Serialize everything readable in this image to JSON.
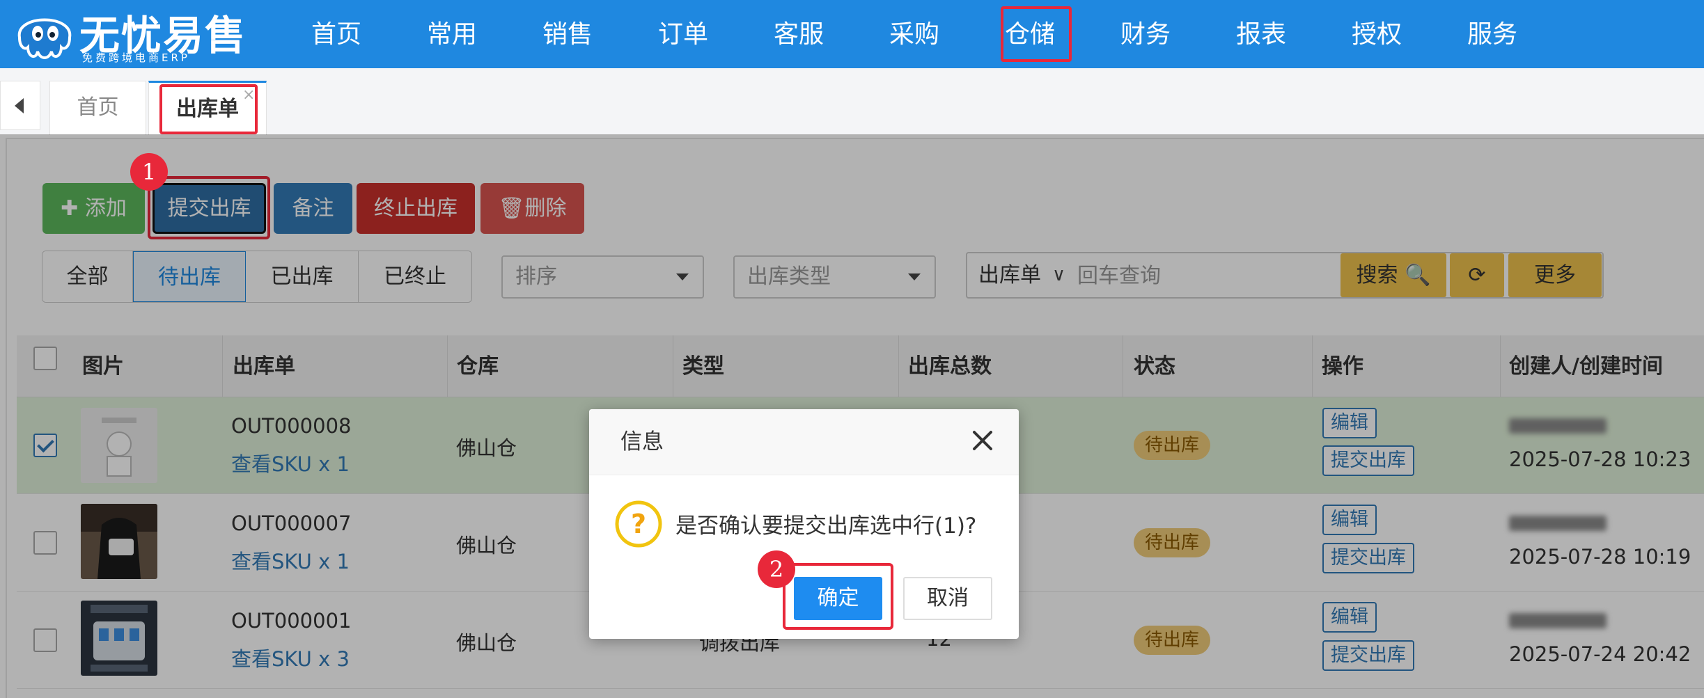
{
  "brand": {
    "name": "无忧易售",
    "tagline": "免费跨境电商ERP"
  },
  "nav": [
    "首页",
    "常用",
    "销售",
    "订单",
    "客服",
    "采购",
    "仓储",
    "财务",
    "报表",
    "授权",
    "服务"
  ],
  "tabs": {
    "home": "首页",
    "active": "出库单",
    "close": "×"
  },
  "toolbar": {
    "add": "添加",
    "submit": "提交出库",
    "note": "备注",
    "stop": "终止出库",
    "delete": "删除"
  },
  "filters": [
    "全部",
    "待出库",
    "已出库",
    "已终止"
  ],
  "selects": {
    "sort": "排序",
    "type": "出库类型"
  },
  "search": {
    "type": "出库单",
    "caret": "∨",
    "placeholder": "回车查询",
    "button": "搜索",
    "more": "更多"
  },
  "table": {
    "headers": [
      "图片",
      "出库单",
      "仓库",
      "类型",
      "出库总数",
      "状态",
      "操作",
      "创建人/创建时间"
    ],
    "rows": [
      {
        "order": "OUT000008",
        "sku": "查看SKU x 1",
        "warehouse": "佛山仓",
        "type": "",
        "total": "",
        "status": "待出库",
        "edit": "编辑",
        "submit": "提交出库",
        "time": "2025-07-28 10:23"
      },
      {
        "order": "OUT000007",
        "sku": "查看SKU x 1",
        "warehouse": "佛山仓",
        "type": "",
        "total": "",
        "status": "待出库",
        "edit": "编辑",
        "submit": "提交出库",
        "time": "2025-07-28 10:19"
      },
      {
        "order": "OUT000001",
        "sku": "查看SKU x 3",
        "warehouse": "佛山仓",
        "type": "调拨出库",
        "total": "12",
        "status": "待出库",
        "edit": "编辑",
        "submit": "提交出库",
        "time": "2025-07-24 20:42"
      }
    ]
  },
  "modal": {
    "title": "信息",
    "message": "是否确认要提交出库选中行(1)?",
    "ok": "确定",
    "cancel": "取消"
  },
  "markers": [
    "1",
    "2"
  ],
  "colors": {
    "primary": "#1f88e0",
    "highlight": "#e8283a",
    "success": "#5cb85c",
    "danger": "#d9534f",
    "warning": "#eec24e"
  }
}
